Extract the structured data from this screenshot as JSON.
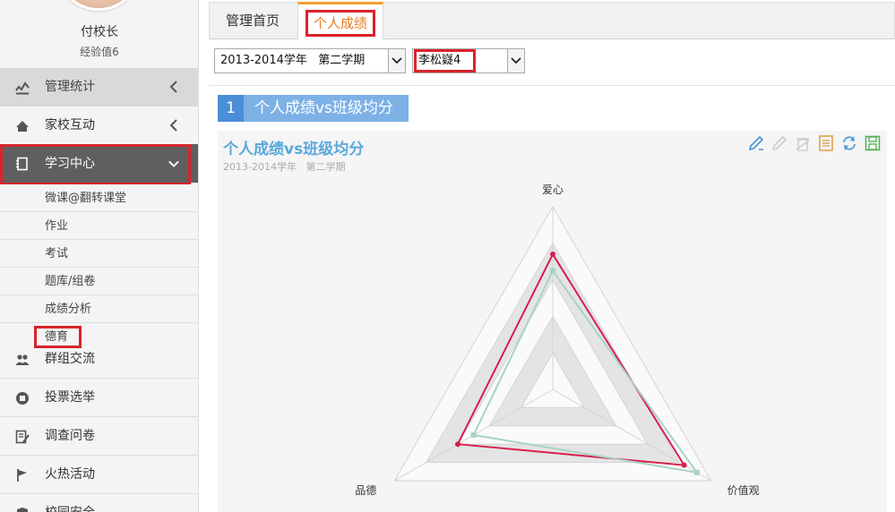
{
  "sidebar": {
    "user_name": "付校长",
    "user_exp": "经验值6",
    "menu": [
      {
        "label": "管理统计",
        "icon": "stats-icon"
      },
      {
        "label": "家校互动",
        "icon": "home-icon"
      },
      {
        "label": "学习中心",
        "icon": "notebook-icon"
      }
    ],
    "sub_items": [
      {
        "label": "微课@翻转课堂"
      },
      {
        "label": "作业"
      },
      {
        "label": "考试"
      },
      {
        "label": "题库/组卷"
      },
      {
        "label": "成绩分析"
      },
      {
        "label": "德育"
      }
    ],
    "bottom_menu": [
      {
        "label": "群组交流",
        "icon": "users-icon"
      },
      {
        "label": "投票选举",
        "icon": "vote-icon"
      },
      {
        "label": "调查问卷",
        "icon": "survey-icon"
      },
      {
        "label": "火热活动",
        "icon": "flag-icon"
      },
      {
        "label": "校园安全",
        "icon": "shield-icon"
      }
    ]
  },
  "tabs": [
    {
      "label": "管理首页",
      "active": false
    },
    {
      "label": "个人成绩",
      "active": true
    }
  ],
  "filters": {
    "term": "2013-2014学年   第二学期",
    "student": "李松嶷4"
  },
  "section": {
    "number": "1",
    "title": "个人成绩vs班级均分"
  },
  "colors": {
    "accent_tab": "#e87d1e",
    "highlight_box": "#d9232c",
    "personal_series": "#d6204e",
    "class_series": "#a9d3c4"
  },
  "toolbox": [
    "edit-pen-icon",
    "eraser-icon",
    "clear-icon",
    "data-view-icon",
    "refresh-icon",
    "save-image-icon"
  ],
  "chart_data": {
    "type": "radar",
    "title": "个人成绩vs班级均分",
    "subtitle": "2013-2014学年   第二学期",
    "indicators": [
      "爱心",
      "价值观",
      "品德"
    ],
    "max": 100,
    "split_number": 5,
    "series": [
      {
        "values": [
          74,
          83,
          60
        ]
      },
      {
        "values": [
          65,
          91,
          50
        ]
      }
    ]
  }
}
